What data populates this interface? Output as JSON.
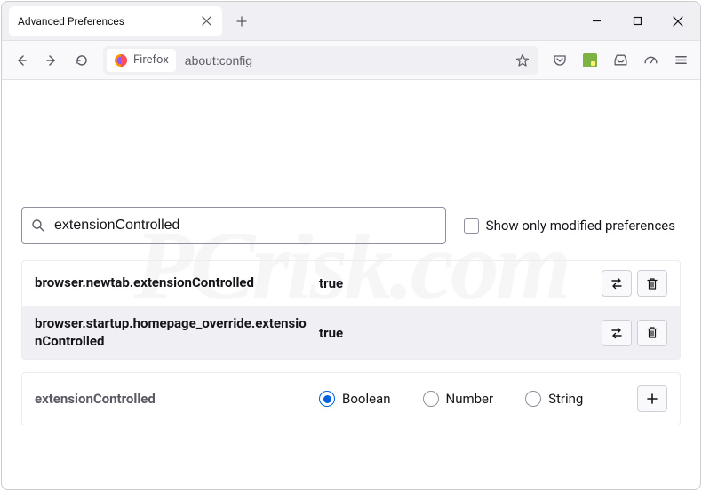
{
  "tab": {
    "title": "Advanced Preferences"
  },
  "addr": {
    "identity": "Firefox",
    "url": "about:config"
  },
  "search": {
    "value": "extensionControlled",
    "show_modified_label": "Show only modified preferences"
  },
  "prefs": [
    {
      "name": "browser.newtab.extensionControlled",
      "value": "true"
    },
    {
      "name": "browser.startup.homepage_override.extensionControlled",
      "value": "true"
    }
  ],
  "new_pref": {
    "name": "extensionControlled",
    "types": [
      "Boolean",
      "Number",
      "String"
    ],
    "selected": "Boolean"
  },
  "watermark": "PCrisk.com"
}
